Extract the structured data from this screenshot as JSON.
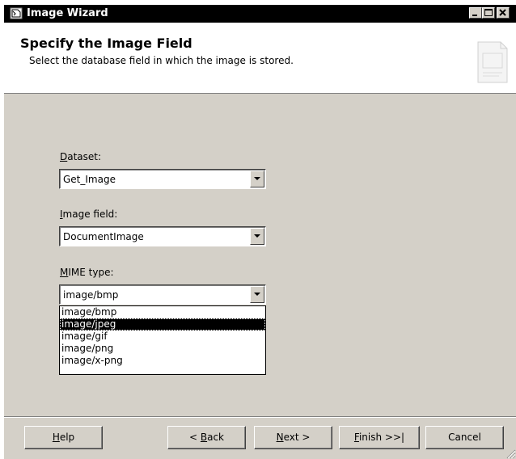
{
  "window": {
    "title": "Image Wizard",
    "controls": {
      "minimize": "_",
      "maximize": "□",
      "close": "×"
    }
  },
  "header": {
    "title": "Specify the Image Field",
    "subtitle": "Select the database field in which the image is stored."
  },
  "fields": {
    "dataset": {
      "label_key": "D",
      "label_rest": "ataset:",
      "value": "Get_Image"
    },
    "image_field": {
      "label_key": "I",
      "label_rest": "mage field:",
      "value": "DocumentImage"
    },
    "mime_type": {
      "label_key": "M",
      "label_rest": "IME type:",
      "value": "image/bmp"
    }
  },
  "mime_dropdown": {
    "open": true,
    "selected": "image/jpeg",
    "options": [
      "image/bmp",
      "image/jpeg",
      "image/gif",
      "image/png",
      "image/x-png"
    ]
  },
  "buttons": {
    "help": {
      "key": "H",
      "rest": "elp"
    },
    "back": {
      "pre": "< ",
      "key": "B",
      "rest": "ack"
    },
    "next": {
      "key": "N",
      "rest": "ext >"
    },
    "finish": {
      "key": "F",
      "rest": "inish >>|"
    },
    "cancel": {
      "label": "Cancel"
    }
  },
  "colors": {
    "face": "#d4d0c8",
    "selection": "#000000",
    "titlebar": "#000000"
  }
}
